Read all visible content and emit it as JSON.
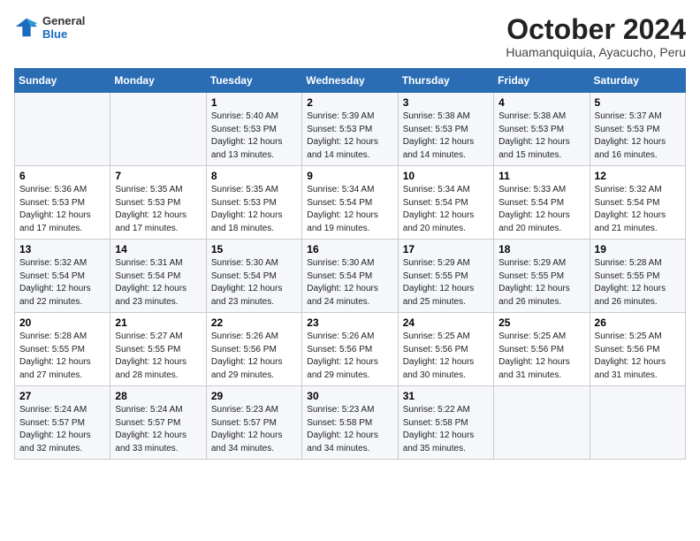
{
  "logo": {
    "general": "General",
    "blue": "Blue"
  },
  "title": "October 2024",
  "subtitle": "Huamanquiquia, Ayacucho, Peru",
  "headers": [
    "Sunday",
    "Monday",
    "Tuesday",
    "Wednesday",
    "Thursday",
    "Friday",
    "Saturday"
  ],
  "weeks": [
    [
      {
        "day": "",
        "info": ""
      },
      {
        "day": "",
        "info": ""
      },
      {
        "day": "1",
        "info": "Sunrise: 5:40 AM\nSunset: 5:53 PM\nDaylight: 12 hours and 13 minutes."
      },
      {
        "day": "2",
        "info": "Sunrise: 5:39 AM\nSunset: 5:53 PM\nDaylight: 12 hours and 14 minutes."
      },
      {
        "day": "3",
        "info": "Sunrise: 5:38 AM\nSunset: 5:53 PM\nDaylight: 12 hours and 14 minutes."
      },
      {
        "day": "4",
        "info": "Sunrise: 5:38 AM\nSunset: 5:53 PM\nDaylight: 12 hours and 15 minutes."
      },
      {
        "day": "5",
        "info": "Sunrise: 5:37 AM\nSunset: 5:53 PM\nDaylight: 12 hours and 16 minutes."
      }
    ],
    [
      {
        "day": "6",
        "info": "Sunrise: 5:36 AM\nSunset: 5:53 PM\nDaylight: 12 hours and 17 minutes."
      },
      {
        "day": "7",
        "info": "Sunrise: 5:35 AM\nSunset: 5:53 PM\nDaylight: 12 hours and 17 minutes."
      },
      {
        "day": "8",
        "info": "Sunrise: 5:35 AM\nSunset: 5:53 PM\nDaylight: 12 hours and 18 minutes."
      },
      {
        "day": "9",
        "info": "Sunrise: 5:34 AM\nSunset: 5:54 PM\nDaylight: 12 hours and 19 minutes."
      },
      {
        "day": "10",
        "info": "Sunrise: 5:34 AM\nSunset: 5:54 PM\nDaylight: 12 hours and 20 minutes."
      },
      {
        "day": "11",
        "info": "Sunrise: 5:33 AM\nSunset: 5:54 PM\nDaylight: 12 hours and 20 minutes."
      },
      {
        "day": "12",
        "info": "Sunrise: 5:32 AM\nSunset: 5:54 PM\nDaylight: 12 hours and 21 minutes."
      }
    ],
    [
      {
        "day": "13",
        "info": "Sunrise: 5:32 AM\nSunset: 5:54 PM\nDaylight: 12 hours and 22 minutes."
      },
      {
        "day": "14",
        "info": "Sunrise: 5:31 AM\nSunset: 5:54 PM\nDaylight: 12 hours and 23 minutes."
      },
      {
        "day": "15",
        "info": "Sunrise: 5:30 AM\nSunset: 5:54 PM\nDaylight: 12 hours and 23 minutes."
      },
      {
        "day": "16",
        "info": "Sunrise: 5:30 AM\nSunset: 5:54 PM\nDaylight: 12 hours and 24 minutes."
      },
      {
        "day": "17",
        "info": "Sunrise: 5:29 AM\nSunset: 5:55 PM\nDaylight: 12 hours and 25 minutes."
      },
      {
        "day": "18",
        "info": "Sunrise: 5:29 AM\nSunset: 5:55 PM\nDaylight: 12 hours and 26 minutes."
      },
      {
        "day": "19",
        "info": "Sunrise: 5:28 AM\nSunset: 5:55 PM\nDaylight: 12 hours and 26 minutes."
      }
    ],
    [
      {
        "day": "20",
        "info": "Sunrise: 5:28 AM\nSunset: 5:55 PM\nDaylight: 12 hours and 27 minutes."
      },
      {
        "day": "21",
        "info": "Sunrise: 5:27 AM\nSunset: 5:55 PM\nDaylight: 12 hours and 28 minutes."
      },
      {
        "day": "22",
        "info": "Sunrise: 5:26 AM\nSunset: 5:56 PM\nDaylight: 12 hours and 29 minutes."
      },
      {
        "day": "23",
        "info": "Sunrise: 5:26 AM\nSunset: 5:56 PM\nDaylight: 12 hours and 29 minutes."
      },
      {
        "day": "24",
        "info": "Sunrise: 5:25 AM\nSunset: 5:56 PM\nDaylight: 12 hours and 30 minutes."
      },
      {
        "day": "25",
        "info": "Sunrise: 5:25 AM\nSunset: 5:56 PM\nDaylight: 12 hours and 31 minutes."
      },
      {
        "day": "26",
        "info": "Sunrise: 5:25 AM\nSunset: 5:56 PM\nDaylight: 12 hours and 31 minutes."
      }
    ],
    [
      {
        "day": "27",
        "info": "Sunrise: 5:24 AM\nSunset: 5:57 PM\nDaylight: 12 hours and 32 minutes."
      },
      {
        "day": "28",
        "info": "Sunrise: 5:24 AM\nSunset: 5:57 PM\nDaylight: 12 hours and 33 minutes."
      },
      {
        "day": "29",
        "info": "Sunrise: 5:23 AM\nSunset: 5:57 PM\nDaylight: 12 hours and 34 minutes."
      },
      {
        "day": "30",
        "info": "Sunrise: 5:23 AM\nSunset: 5:58 PM\nDaylight: 12 hours and 34 minutes."
      },
      {
        "day": "31",
        "info": "Sunrise: 5:22 AM\nSunset: 5:58 PM\nDaylight: 12 hours and 35 minutes."
      },
      {
        "day": "",
        "info": ""
      },
      {
        "day": "",
        "info": ""
      }
    ]
  ]
}
